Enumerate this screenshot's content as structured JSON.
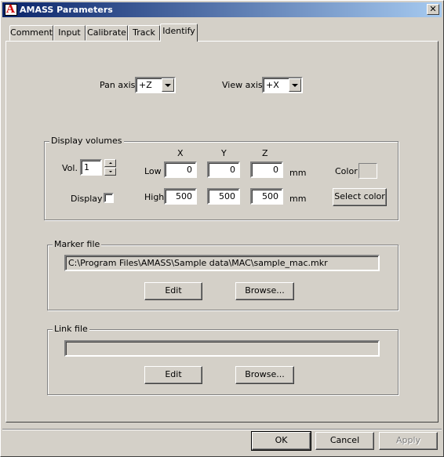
{
  "window": {
    "title": "AMASS Parameters",
    "close_glyph": "✕"
  },
  "tabs": [
    {
      "label": "Comment"
    },
    {
      "label": "Input"
    },
    {
      "label": "Calibrate"
    },
    {
      "label": "Track"
    },
    {
      "label": "Identify",
      "active": true
    }
  ],
  "axes": {
    "pan_label": "Pan axis",
    "pan_value": "+Z",
    "view_label": "View axis",
    "view_value": "+X"
  },
  "display_volumes": {
    "title": "Display volumes",
    "vol_label": "Vol.",
    "vol_value": "1",
    "display_label": "Display",
    "display_checked": false,
    "col_x": "X",
    "col_y": "Y",
    "col_z": "Z",
    "low_label": "Low",
    "low": {
      "x": "0",
      "y": "0",
      "z": "0"
    },
    "high_label": "High",
    "high": {
      "x": "500",
      "y": "500",
      "z": "500"
    },
    "unit_low": "mm",
    "unit_high": "mm",
    "color_label": "Color",
    "select_color_label": "Select color"
  },
  "marker_file": {
    "title": "Marker file",
    "path": "C:\\Program Files\\AMASS\\Sample data\\MAC\\sample_mac.mkr",
    "edit_label": "Edit",
    "browse_label": "Browse..."
  },
  "link_file": {
    "title": "Link file",
    "path": "",
    "edit_label": "Edit",
    "browse_label": "Browse..."
  },
  "footer": {
    "ok_label": "OK",
    "cancel_label": "Cancel",
    "apply_label": "Apply"
  }
}
